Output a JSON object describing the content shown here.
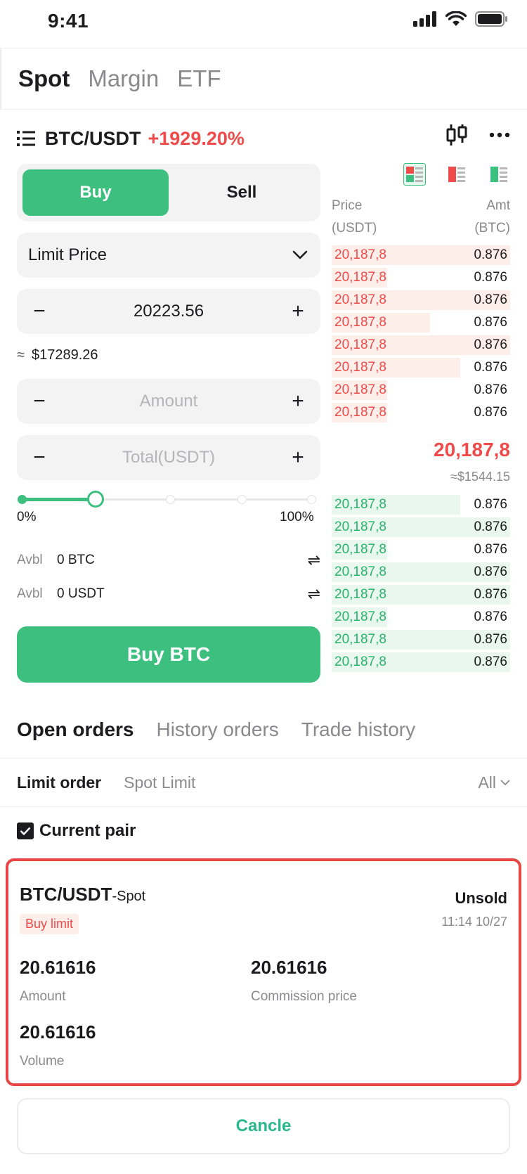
{
  "status_bar": {
    "time": "9:41"
  },
  "mode_tabs": [
    "Spot",
    "Margin",
    "ETF"
  ],
  "pair": {
    "name": "BTC/USDT",
    "change": "+1929.20%"
  },
  "trade_form": {
    "buy_label": "Buy",
    "sell_label": "Sell",
    "order_type": "Limit Price",
    "price_value": "20223.56",
    "approx_symbol": "≈",
    "approx_value": "$17289.26",
    "amount_placeholder": "Amount",
    "total_placeholder": "Total(USDT)",
    "minus": "−",
    "plus": "+",
    "slider": {
      "level": 0.25,
      "min_label": "0%",
      "max_label": "100%"
    },
    "avbl": [
      {
        "key": "Avbl",
        "value": "0 BTC",
        "swap": "⇌"
      },
      {
        "key": "Avbl",
        "value": "0 USDT",
        "swap": "⇌"
      }
    ],
    "submit_label": "Buy BTC"
  },
  "order_book": {
    "header": {
      "price": "Price",
      "price_unit": "(USDT)",
      "amount": "Amt",
      "amount_unit": "(BTC)"
    },
    "asks": [
      {
        "price": "20,187,8",
        "amount": "0.876",
        "depth": 1.0
      },
      {
        "price": "20,187,8",
        "amount": "0.876",
        "depth": 0.31
      },
      {
        "price": "20,187,8",
        "amount": "0.876",
        "depth": 1.0
      },
      {
        "price": "20,187,8",
        "amount": "0.876",
        "depth": 0.55
      },
      {
        "price": "20,187,8",
        "amount": "0.876",
        "depth": 1.0
      },
      {
        "price": "20,187,8",
        "amount": "0.876",
        "depth": 0.72
      },
      {
        "price": "20,187,8",
        "amount": "0.876",
        "depth": 0.31
      },
      {
        "price": "20,187,8",
        "amount": "0.876",
        "depth": 0.31
      }
    ],
    "last_price": "20,187,8",
    "last_price_usd": "≈$1544.15",
    "bids": [
      {
        "price": "20,187,8",
        "amount": "0.876",
        "depth": 0.72
      },
      {
        "price": "20,187,8",
        "amount": "0.876",
        "depth": 1.0
      },
      {
        "price": "20,187,8",
        "amount": "0.876",
        "depth": 0.31
      },
      {
        "price": "20,187,8",
        "amount": "0.876",
        "depth": 1.0
      },
      {
        "price": "20,187,8",
        "amount": "0.876",
        "depth": 1.0
      },
      {
        "price": "20,187,8",
        "amount": "0.876",
        "depth": 0.31
      },
      {
        "price": "20,187,8",
        "amount": "0.876",
        "depth": 1.0
      },
      {
        "price": "20,187,8",
        "amount": "0.876",
        "depth": 1.0
      }
    ]
  },
  "orders": {
    "tabs": [
      "Open orders",
      "History orders",
      "Trade history"
    ],
    "subtabs": [
      "Limit order",
      "Spot Limit"
    ],
    "filter_label": "All",
    "current_pair_label": "Current pair",
    "card": {
      "pair": "BTC/USDT",
      "market": "-Spot",
      "badge": "Buy limit",
      "status": "Unsold",
      "time": "11:14 10/27",
      "amount_value": "20.61616",
      "amount_label": "Amount",
      "commission_value": "20.61616",
      "commission_label": "Commission price",
      "volume_value": "20.61616",
      "volume_label": "Volume"
    },
    "cancel_label": "Cancle"
  },
  "colors": {
    "buy": "#3dbf7f",
    "sell": "#f04b4b",
    "highlight": "#e84545",
    "cancel": "#2ab88a"
  },
  "icons": [
    "signal-icon",
    "wifi-icon",
    "battery-icon",
    "menu-icon",
    "candlestick-icon",
    "more-icon",
    "book-both-icon",
    "book-asks-icon",
    "book-bids-icon",
    "chevron-down-icon",
    "swap-icon",
    "check-icon"
  ]
}
